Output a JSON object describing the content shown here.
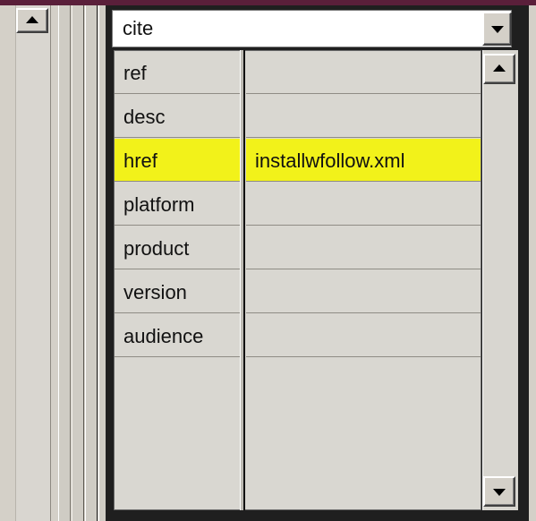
{
  "dropdown": {
    "value": "cite"
  },
  "properties": [
    {
      "name": "ref",
      "value": ""
    },
    {
      "name": "desc",
      "value": ""
    },
    {
      "name": "href",
      "value": "installwfollow.xml",
      "selected": true
    },
    {
      "name": "platform",
      "value": ""
    },
    {
      "name": "product",
      "value": ""
    },
    {
      "name": "version",
      "value": ""
    },
    {
      "name": "audience",
      "value": ""
    }
  ],
  "colors": {
    "selected_row": "#f2f21a",
    "window_strip": "#5a1f3a"
  },
  "icons": {
    "scroll_up": "arrow-up-icon",
    "scroll_down": "arrow-down-icon",
    "dropdown": "chevron-down-icon"
  }
}
